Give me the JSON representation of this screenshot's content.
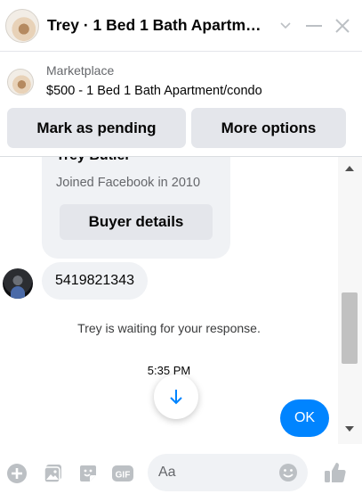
{
  "header": {
    "title": "Trey · 1 Bed 1 Bath Apartm…",
    "icons": [
      "house-avatar",
      "chevron-down-icon",
      "minimize-icon",
      "close-icon"
    ]
  },
  "marketplace": {
    "label": "Marketplace",
    "listing": "$500 - 1 Bed 1 Bath Apartment/condo",
    "buttons": {
      "pending": "Mark as pending",
      "more": "More options"
    }
  },
  "profile_card": {
    "name": "Trey Butler",
    "joined": "Joined Facebook in 2010",
    "button": "Buyer details"
  },
  "messages": {
    "incoming": "5419821343",
    "waiting": "Trey is waiting for your response.",
    "time": "5:35 PM",
    "outgoing": "OK"
  },
  "composer": {
    "placeholder": "Aa",
    "icons": [
      "plus-icon",
      "photo-icon",
      "sticker-icon",
      "gif-icon",
      "emoji-icon",
      "like-icon"
    ],
    "gif_label": "GIF"
  },
  "colors": {
    "accent": "#0084ff",
    "bubble_gray": "#f0f2f5",
    "button_gray": "#e4e6eb",
    "icon_gray": "#bcc0c4"
  }
}
